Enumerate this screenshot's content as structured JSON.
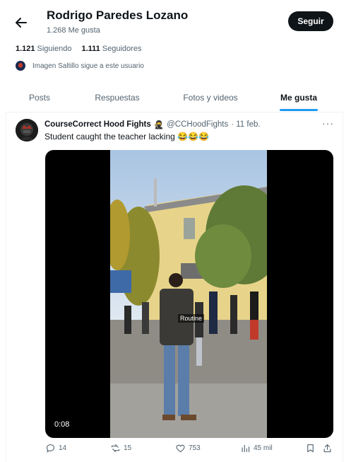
{
  "header": {
    "name": "Rodrigo Paredes Lozano",
    "likes_count": "1.268 Me gusta",
    "follow_label": "Seguir"
  },
  "profile": {
    "following_count": "1.121",
    "following_label": "Siguiendo",
    "followers_count": "1.111",
    "followers_label": "Seguidores",
    "follows_you_text": "Imagen Saltillo sigue a este usuario"
  },
  "tabs": [
    {
      "label": "Posts",
      "active": false
    },
    {
      "label": "Respuestas",
      "active": false
    },
    {
      "label": "Fotos y videos",
      "active": false
    },
    {
      "label": "Me gusta",
      "active": true
    }
  ],
  "post": {
    "author_name": "CourseCorrect Hood Fights",
    "author_emoji": "🥷",
    "handle": "@CCHoodFights",
    "date": "· 11 feb.",
    "text": "Student caught the teacher lacking 😂😂😂",
    "video": {
      "time": "0:08",
      "caption": "Routine"
    },
    "actions": {
      "replies": "14",
      "reposts": "15",
      "likes": "753",
      "views": "45 mil"
    }
  },
  "colors": {
    "accent": "#1d9bf0",
    "text": "#0f1419",
    "secondary": "#536471",
    "repost_green": "#00ba7c",
    "like_pink": "#f91880"
  }
}
